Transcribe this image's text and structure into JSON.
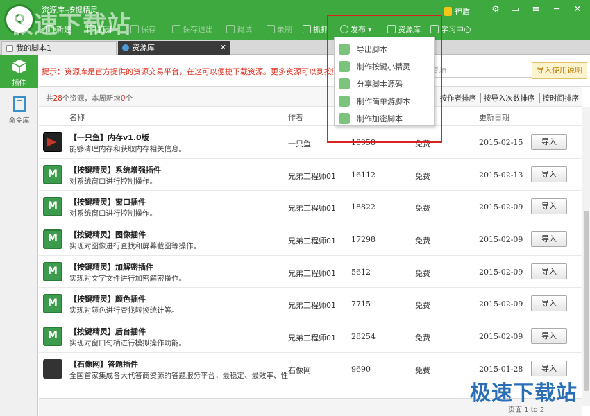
{
  "app": {
    "title": "资源库-按键精灵",
    "watermark": "极速下载站",
    "user": "神盾"
  },
  "toolbar": [
    {
      "label": "新建",
      "dim": false
    },
    {
      "label": "打开",
      "dim": false
    },
    {
      "label": "保存",
      "dim": true
    },
    {
      "label": "保存退出",
      "dim": true
    },
    {
      "label": "调试",
      "dim": true
    },
    {
      "label": "录制",
      "dim": true
    },
    {
      "label": "抓抓",
      "dim": false
    },
    {
      "label": "发布",
      "dim": false
    },
    {
      "label": "资源库",
      "dim": false
    },
    {
      "label": "学习中心",
      "dim": false
    }
  ],
  "tabs": [
    {
      "label": "我的脚本1"
    },
    {
      "label": "资源库"
    }
  ],
  "sidebar": [
    {
      "label": "插件"
    },
    {
      "label": "命令库"
    }
  ],
  "tip": "提示：资源库是官方提供的资源交易平台，在这可以便捷下载资源。更多资源可以到按键精灵论坛",
  "search_text": "资源",
  "help_label": "导入使用说明",
  "summary": {
    "prefix": "共",
    "count": "28",
    "mid": "个资源，本周新增",
    "new": "0",
    "suffix": "个"
  },
  "sorts": [
    "排序",
    "按作者排序",
    "按导入次数排序",
    "按时间排序"
  ],
  "columns": {
    "name": "名称",
    "author": "作者",
    "updated": "更新日期"
  },
  "rows": [
    {
      "name": "【一只鱼】内存v1.0版",
      "desc": "能够清理内存和获取内存相关信息。",
      "author": "一只鱼",
      "downloads": "10958",
      "price": "免费",
      "date": "2015-02-15",
      "icon": "fish"
    },
    {
      "name": "【按键精灵】系统增强插件",
      "desc": "对系统窗口进行控制操作。",
      "author": "兄弟工程师01",
      "downloads": "16112",
      "price": "免费",
      "date": "2015-02-13",
      "icon": "m"
    },
    {
      "name": "【按键精灵】窗口插件",
      "desc": "对系统窗口进行控制操作。",
      "author": "兄弟工程师01",
      "downloads": "18822",
      "price": "免费",
      "date": "2015-02-09",
      "icon": "m"
    },
    {
      "name": "【按键精灵】图像插件",
      "desc": "实现对图像进行查找和屏幕截图等操作。",
      "author": "兄弟工程师01",
      "downloads": "17298",
      "price": "免费",
      "date": "2015-02-09",
      "icon": "m"
    },
    {
      "name": "【按键精灵】加解密插件",
      "desc": "实现对文字文件进行加密解密操作。",
      "author": "兄弟工程师01",
      "downloads": "5612",
      "price": "免费",
      "date": "2015-02-09",
      "icon": "m"
    },
    {
      "name": "【按键精灵】颜色插件",
      "desc": "实现对颜色进行查找转换统计等。",
      "author": "兄弟工程师01",
      "downloads": "7715",
      "price": "免费",
      "date": "2015-02-09",
      "icon": "m"
    },
    {
      "name": "【按键精灵】后台插件",
      "desc": "实现对窗口句柄进行模拟操作功能。",
      "author": "兄弟工程师01",
      "downloads": "28254",
      "price": "免费",
      "date": "2015-02-09",
      "icon": "m"
    },
    {
      "name": "【石像网】答题插件",
      "desc": "全国首家集成各大代答商资源的答题服务平台，最稳定、最效率、性",
      "author": "石像网",
      "downloads": "9690",
      "price": "免费",
      "date": "2015-01-28",
      "icon": "stone"
    }
  ],
  "import_label": "导入",
  "footer_page": "页面  1 to 2",
  "publish_menu": [
    "导出脚本",
    "制作按键小精灵",
    "分享脚本源码",
    "制作简单游脚本",
    "制作加密脚本"
  ],
  "colors": {
    "green": "#3da93f",
    "highlight": "#d9231f"
  }
}
